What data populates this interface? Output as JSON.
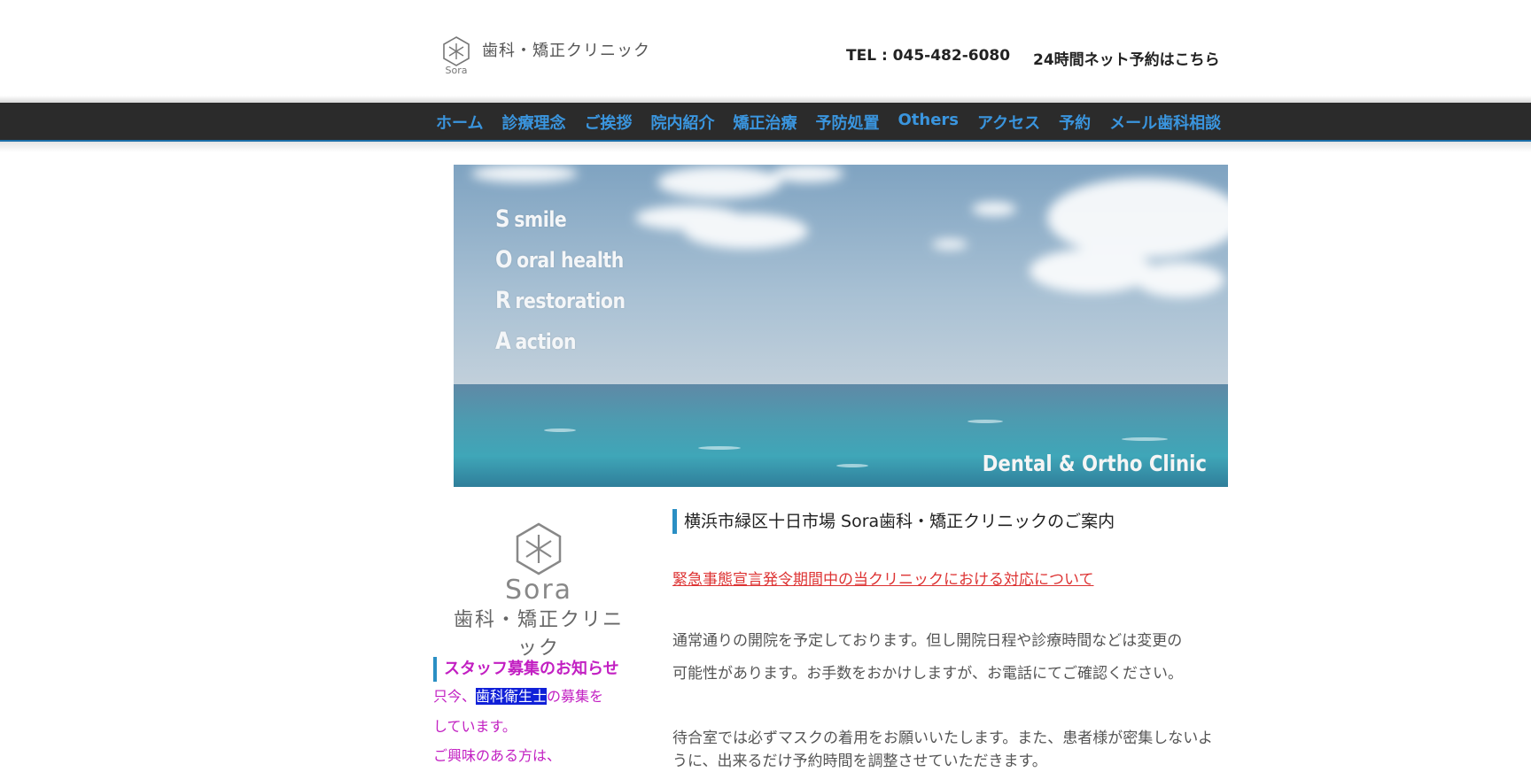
{
  "header": {
    "logo_text": "歯科・矯正クリニック",
    "tel": "TEL : 045-482-6080",
    "reserve_link": "24時間ネット予約はこちら"
  },
  "nav": {
    "items": [
      "ホーム",
      "診療理念",
      "ご挨拶",
      "院内紹介",
      "矯正治療",
      "予防処置",
      "Others",
      "アクセス",
      "予約",
      "メール歯科相談"
    ]
  },
  "hero": {
    "lines": [
      {
        "cap": "S",
        "word": "smile"
      },
      {
        "cap": "O",
        "word": "oral health"
      },
      {
        "cap": "R",
        "word": "restoration"
      },
      {
        "cap": "A",
        "word": "action"
      }
    ],
    "tagline": "Dental & Ortho Clinic"
  },
  "sidebar": {
    "logo_word": "Sora",
    "logo_text": "歯科・矯正クリニック",
    "heading": "スタッフ募集のお知らせ",
    "line1_pre": "只今、",
    "line1_hl": "歯科衛生士",
    "line1_post": "の募集を",
    "line2": "しています。",
    "line3": "ご興味のある方は、"
  },
  "main": {
    "heading": "横浜市緑区十日市場 Sora歯科・矯正クリニックのご案内",
    "notice_link": "緊急事態宣言発令期間中の当クリニックにおける対応について",
    "para1_line1": "通常通りの開院を予定しております。但し開院日程や診療時間などは変更の",
    "para1_line2": "可能性があります。お手数をおかけしますが、お電話にてご確認ください。",
    "para2_line1": "待合室では必ずマスクの着用をお願いいたします。また、患者様が密集しないよ",
    "para2_line2": "うに、出来るだけ予約時間を調整させていただきます。"
  }
}
